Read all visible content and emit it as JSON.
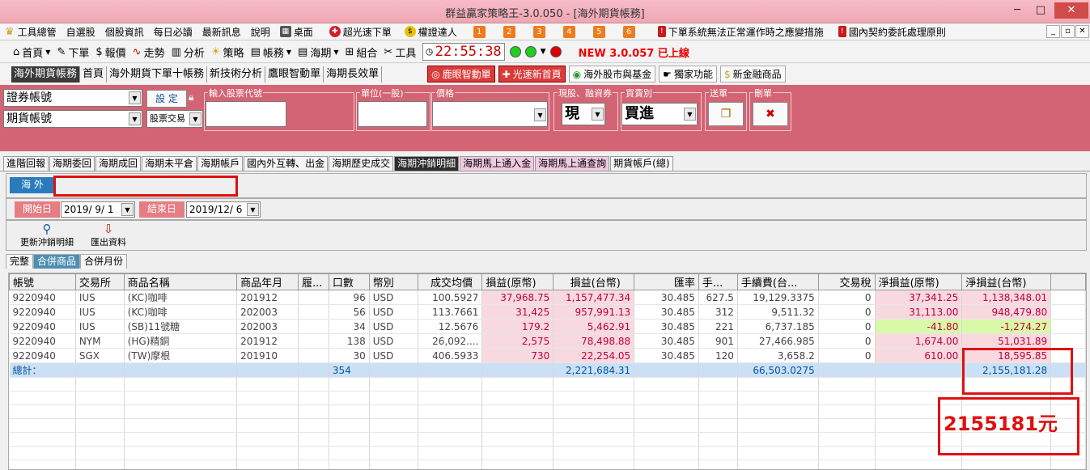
{
  "window": {
    "title": "群益贏家策略王-3.0.050 - [海外期貨帳務]",
    "min": "─",
    "max": "□",
    "close": "✕"
  },
  "menu": {
    "items": [
      "工具總管",
      "自選股",
      "個股資訊",
      "每日必讀",
      "最新訊息",
      "說明",
      "桌面",
      "超光速下單",
      "權證達人"
    ],
    "numbers": [
      "1",
      "2",
      "3",
      "4",
      "5",
      "6"
    ],
    "notices": [
      "下單系統無法正常運作時之應變措施",
      "國內契約委託處理原則"
    ],
    "mdi": [
      "_",
      "▫",
      "✕"
    ]
  },
  "toolbar": {
    "items": [
      "首頁",
      "下單",
      "報價",
      "走勢",
      "分析",
      "策略",
      "帳務",
      "海期",
      "組合",
      "工具"
    ],
    "clock": "22:55:38",
    "new_version": "NEW 3.0.057 已上線"
  },
  "tabs1": {
    "items": [
      "海外期貨帳務",
      "首頁",
      "海外期貨下單十帳務",
      "新技術分析",
      "鷹眼智動單",
      "海期長效單"
    ],
    "buttons": [
      "鹿眼智動單",
      "光速新首頁",
      "海外股市與基金",
      "獨家功能",
      "新金融商品"
    ]
  },
  "order_panel": {
    "account_select": "證券帳號",
    "futures_select": "期貨帳號",
    "set_button": "設 定",
    "trade_type": "股票交易",
    "label_code": "輸入股票代號",
    "label_unit": "單位(一股)",
    "label_price": "價格",
    "label_type": "現股、融資券",
    "type_value": "現",
    "label_side": "買賣別",
    "side_value": "買進",
    "label_send": "送單",
    "label_delete": "刪單"
  },
  "tabs2": {
    "items": [
      "進階回報",
      "海期委回",
      "海期成回",
      "海期未平倉",
      "海期帳戶",
      "國內外互轉、出金",
      "海期歷史成交",
      "海期沖銷明細",
      "海期馬上通入金",
      "海期馬上通查詢",
      "期貨帳戶(總)"
    ]
  },
  "filter": {
    "region": "海 外",
    "start_label": "開始日",
    "start_date": "2019/ 9/ 1",
    "end_label": "結束日",
    "end_date": "2019/12/ 6"
  },
  "actions": {
    "refresh": "更新沖銷明細",
    "export": "匯出資料"
  },
  "tabs3": {
    "items": [
      "完整",
      "合併商品",
      "合併月份"
    ]
  },
  "table": {
    "columns": [
      "帳號",
      "交易所",
      "商品名稱",
      "商品年月",
      "履...",
      "口數",
      "幣別",
      "成交均價",
      "損益(原幣)",
      "損益(台幣)",
      "匯率",
      "手...",
      "手續費(台...",
      "交易稅",
      "淨損益(原幣)",
      "淨損益(台幣)"
    ],
    "rows": [
      [
        "9220940",
        "IUS",
        "(KC)咖啡",
        "201912",
        "",
        "96",
        "USD",
        "100.5927",
        "37,968.75",
        "1,157,477.34",
        "30.485",
        "627.5",
        "19,129.3375",
        "0",
        "37,341.25",
        "1,138,348.01"
      ],
      [
        "9220940",
        "IUS",
        "(KC)咖啡",
        "202003",
        "",
        "56",
        "USD",
        "113.7661",
        "31,425",
        "957,991.13",
        "30.485",
        "312",
        "9,511.32",
        "0",
        "31,113.00",
        "948,479.80"
      ],
      [
        "9220940",
        "IUS",
        "(SB)11號糖",
        "202003",
        "",
        "34",
        "USD",
        "12.5676",
        "179.2",
        "5,462.91",
        "30.485",
        "221",
        "6,737.185",
        "0",
        "-41.80",
        "-1,274.27"
      ],
      [
        "9220940",
        "NYM",
        "(HG)精銅",
        "201912",
        "",
        "138",
        "USD",
        "26,092....",
        "2,575",
        "78,498.88",
        "30.485",
        "901",
        "27,466.985",
        "0",
        "1,674.00",
        "51,031.89"
      ],
      [
        "9220940",
        "SGX",
        "(TW)摩根",
        "201910",
        "",
        "30",
        "USD",
        "406.5933",
        "730",
        "22,254.05",
        "30.485",
        "120",
        "3,658.2",
        "0",
        "610.00",
        "18,595.85"
      ]
    ],
    "total": [
      "總計：",
      "",
      "",
      "",
      "",
      "354",
      "",
      "",
      "",
      "2,221,684.31",
      "",
      "",
      "66,503.0275",
      "",
      "",
      "2,155,181.28"
    ]
  },
  "annotation": {
    "text": "2155181元",
    "color": "#e01010"
  }
}
